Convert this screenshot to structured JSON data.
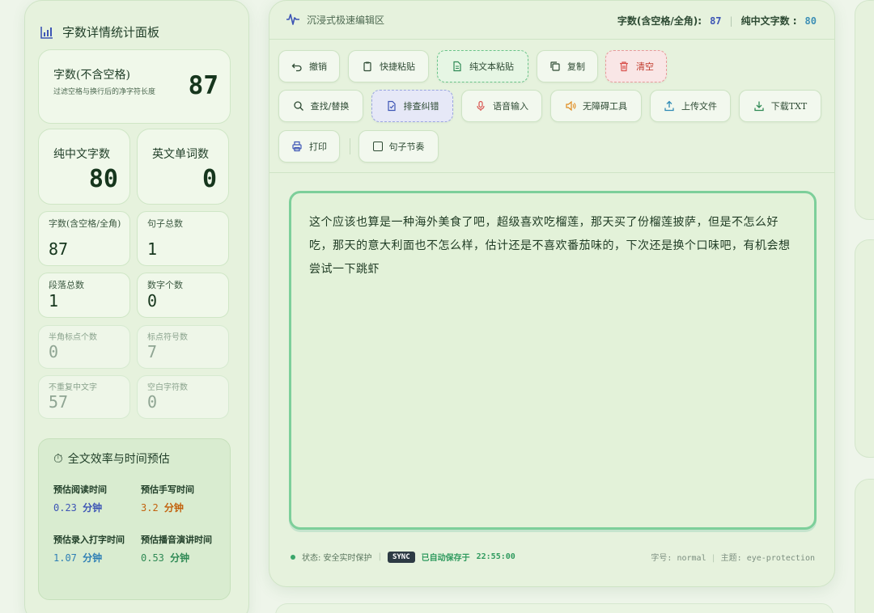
{
  "sidebar": {
    "title": "字数详情统计面板",
    "main_stat": {
      "label": "字数(不含空格)",
      "sub": "过滤空格与换行后的净字符长度",
      "value": "87"
    },
    "pure_chinese": {
      "label": "纯中文字数",
      "value": "80"
    },
    "english_words": {
      "label": "英文单词数",
      "value": "0"
    },
    "stats": [
      {
        "label": "字数(含空格/全角)",
        "value": "87"
      },
      {
        "label": "句子总数",
        "value": "1"
      },
      {
        "label": "段落总数",
        "value": "1"
      },
      {
        "label": "数字个数",
        "value": "0"
      },
      {
        "label": "半角标点个数",
        "value": "0"
      },
      {
        "label": "标点符号数",
        "value": "7"
      },
      {
        "label": "不重复中文字",
        "value": "57"
      },
      {
        "label": "空白字符数",
        "value": "0"
      }
    ],
    "efficiency": {
      "title": "全文效率与时间预估",
      "items": [
        {
          "label": "预估阅读时间",
          "value": "0.23",
          "unit": "分钟",
          "color": "#3d55b5"
        },
        {
          "label": "预估手写时间",
          "value": "3.2",
          "unit": "分钟",
          "color": "#c2620e"
        },
        {
          "label": "预估录入打字时间",
          "value": "1.07",
          "unit": "分钟",
          "color": "#2f7fb5"
        },
        {
          "label": "预估播音演讲时间",
          "value": "0.53",
          "unit": "分钟",
          "color": "#2f8a55"
        }
      ]
    }
  },
  "editor": {
    "brand": "沉浸式极速编辑区",
    "header_stats": {
      "chars_label": "字数(含空格/全角):",
      "chars_value": "87",
      "chinese_label": "纯中文字数 :",
      "chinese_value": "80"
    },
    "toolbar": {
      "undo": "撤销",
      "quick_paste": "快捷粘贴",
      "plain_paste": "纯文本粘贴",
      "copy": "复制",
      "clear": "清空",
      "find_replace": "查找/替换",
      "check_typo": "排查纠错",
      "voice_input": "语音输入",
      "accessibility": "无障碍工具",
      "upload": "上传文件",
      "download": "下载TXT",
      "print": "打印",
      "sentence_rhythm": "句子节奏"
    },
    "content": "这个应该也算是一种海外美食了吧，超级喜欢吃榴莲，那天买了份榴莲披萨，但是不怎么好吃，那天的意大利面也不怎么样，估计还是不喜欢番茄味的，下次还是换个口味吧，有机会想尝试一下跳虾",
    "footer": {
      "status": "状态: 安全实时保护",
      "sync_badge": "SYNC",
      "saved_text": "已自动保存于",
      "saved_time": "22:55:00",
      "font_size": "字号: normal",
      "theme": "主题: eye-protection"
    }
  },
  "colors": {
    "accent_green": "#7dcf9a",
    "panel_bg": "#e6f2dd",
    "danger_red": "#d9534f"
  }
}
